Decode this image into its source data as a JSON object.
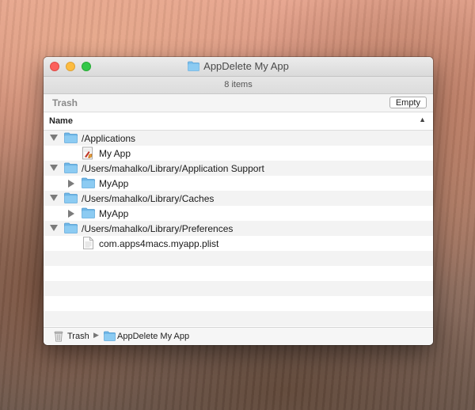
{
  "window": {
    "title": "AppDelete My App",
    "item_count": "8 items",
    "folder_icon": "folder-icon"
  },
  "trashbar": {
    "label": "Trash",
    "empty_button": "Empty"
  },
  "list": {
    "column_name": "Name",
    "sort_icon": "chevron-up-icon",
    "rows": [
      {
        "label": "/Applications",
        "icon": "folder-icon",
        "disclosure": "expanded"
      },
      {
        "label": "My App",
        "icon": "app-icon",
        "disclosure": "none"
      },
      {
        "label": "/Users/mahalko/Library/Application Support",
        "icon": "folder-icon",
        "disclosure": "expanded"
      },
      {
        "label": "MyApp",
        "icon": "folder-icon",
        "disclosure": "collapsed"
      },
      {
        "label": "/Users/mahalko/Library/Caches",
        "icon": "folder-icon",
        "disclosure": "expanded"
      },
      {
        "label": "MyApp",
        "icon": "folder-icon",
        "disclosure": "collapsed"
      },
      {
        "label": "/Users/mahalko/Library/Preferences",
        "icon": "folder-icon",
        "disclosure": "expanded"
      },
      {
        "label": "com.apps4macs.myapp.plist",
        "icon": "document-icon",
        "disclosure": "none"
      }
    ]
  },
  "pathbar": {
    "trash": "Trash",
    "trash_icon": "trash-icon",
    "separator_icon": "chevron-right-icon",
    "folder": "AppDelete My App",
    "folder_icon": "folder-icon"
  },
  "colors": {
    "folder_blue": "#7cc0ec",
    "close": "#fc605c",
    "minimize": "#fdbc40",
    "zoom": "#34c84a"
  }
}
